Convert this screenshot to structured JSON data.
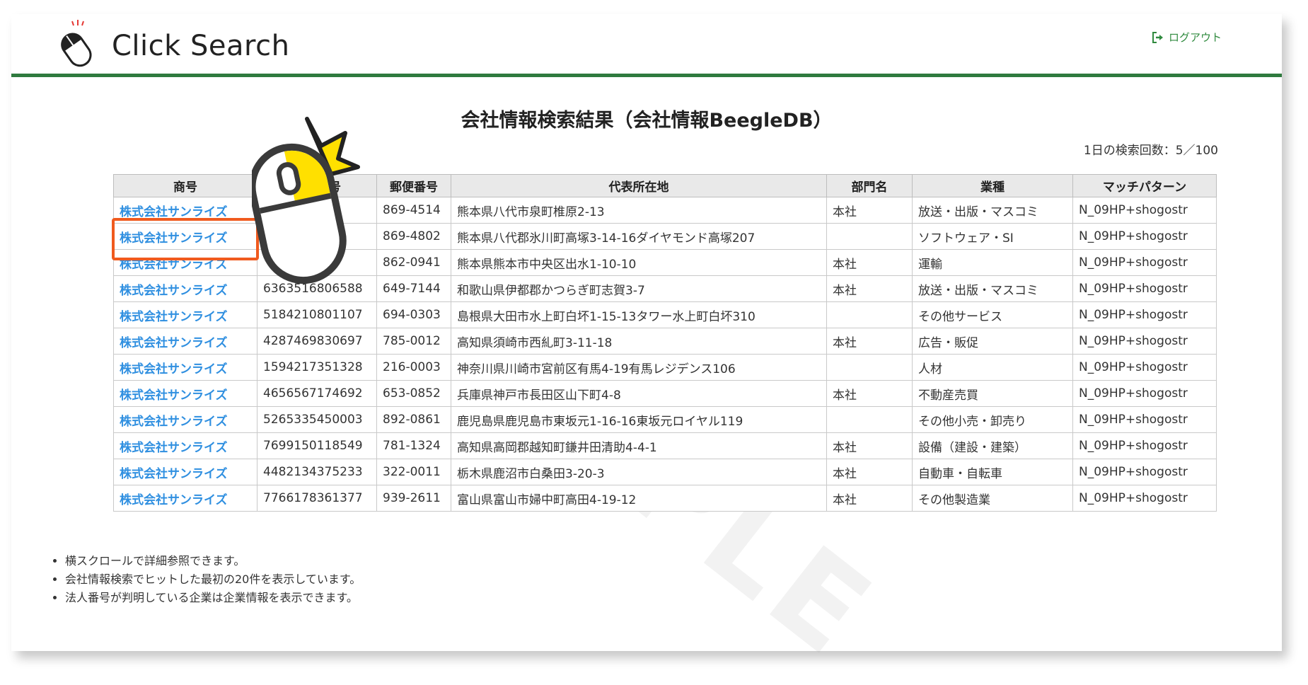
{
  "header": {
    "logo_text": "Click Search",
    "logout_label": "ログアウト"
  },
  "page": {
    "title": "会社情報検索結果（会社情報BeegleDB）",
    "search_count": "1日の検索回数：5／100",
    "watermark": "SAMPLE"
  },
  "table": {
    "columns": [
      "商号",
      "法人番号",
      "郵便番号",
      "代表所在地",
      "部門名",
      "業種",
      "マッチパターン"
    ],
    "rows": [
      {
        "name": "株式会社サンライズ",
        "corp_no": "",
        "zip": "869-4514",
        "address": "熊本県八代市泉町椎原2-13",
        "dept": "本社",
        "industry": "放送・出版・マスコミ",
        "pattern": "N_09HP+shogostr"
      },
      {
        "name": "株式会社サンライズ",
        "corp_no": "",
        "zip": "869-4802",
        "address": "熊本県八代郡氷川町高塚3-14-16ダイヤモンド高塚207",
        "dept": "",
        "industry": "ソフトウェア・SI",
        "pattern": "N_09HP+shogostr"
      },
      {
        "name": "株式会社サンライズ",
        "corp_no": "",
        "zip": "862-0941",
        "address": "熊本県熊本市中央区出水1-10-10",
        "dept": "本社",
        "industry": "運輸",
        "pattern": "N_09HP+shogostr"
      },
      {
        "name": "株式会社サンライズ",
        "corp_no": "6363516806588",
        "zip": "649-7144",
        "address": "和歌山県伊都郡かつらぎ町志賀3-7",
        "dept": "本社",
        "industry": "放送・出版・マスコミ",
        "pattern": "N_09HP+shogostr"
      },
      {
        "name": "株式会社サンライズ",
        "corp_no": "5184210801107",
        "zip": "694-0303",
        "address": "島根県大田市水上町白坏1-15-13タワー水上町白坏310",
        "dept": "",
        "industry": "その他サービス",
        "pattern": "N_09HP+shogostr"
      },
      {
        "name": "株式会社サンライズ",
        "corp_no": "4287469830697",
        "zip": "785-0012",
        "address": "高知県須崎市西糺町3-11-18",
        "dept": "本社",
        "industry": "広告・販促",
        "pattern": "N_09HP+shogostr"
      },
      {
        "name": "株式会社サンライズ",
        "corp_no": "1594217351328",
        "zip": "216-0003",
        "address": "神奈川県川崎市宮前区有馬4-19有馬レジデンス106",
        "dept": "",
        "industry": "人材",
        "pattern": "N_09HP+shogostr"
      },
      {
        "name": "株式会社サンライズ",
        "corp_no": "4656567174692",
        "zip": "653-0852",
        "address": "兵庫県神戸市長田区山下町4-8",
        "dept": "本社",
        "industry": "不動産売買",
        "pattern": "N_09HP+shogostr"
      },
      {
        "name": "株式会社サンライズ",
        "corp_no": "5265335450003",
        "zip": "892-0861",
        "address": "鹿児島県鹿児島市東坂元1-16-16東坂元ロイヤル119",
        "dept": "",
        "industry": "その他小売・卸売り",
        "pattern": "N_09HP+shogostr"
      },
      {
        "name": "株式会社サンライズ",
        "corp_no": "7699150118549",
        "zip": "781-1324",
        "address": "高知県高岡郡越知町鎌井田清助4-4-1",
        "dept": "本社",
        "industry": "設備（建設・建築）",
        "pattern": "N_09HP+shogostr"
      },
      {
        "name": "株式会社サンライズ",
        "corp_no": "4482134375233",
        "zip": "322-0011",
        "address": "栃木県鹿沼市白桑田3-20-3",
        "dept": "本社",
        "industry": "自動車・自転車",
        "pattern": "N_09HP+shogostr"
      },
      {
        "name": "株式会社サンライズ",
        "corp_no": "7766178361377",
        "zip": "939-2611",
        "address": "富山県富山市婦中町高田4-19-12",
        "dept": "本社",
        "industry": "その他製造業",
        "pattern": "N_09HP+shogostr"
      }
    ]
  },
  "notes": [
    "横スクロールで詳細参照できます。",
    "会社情報検索でヒットした最初の20件を表示しています。",
    "法人番号が判明している企業は企業情報を表示できます。"
  ],
  "colors": {
    "accent_green": "#2f7a3e",
    "link_blue": "#2f8fe0",
    "highlight_orange": "#f05a1e",
    "pointer_yellow": "#ffe000"
  },
  "icons": {
    "logo": "mouse-click-icon",
    "logout": "logout-icon",
    "pointer": "mouse-pointer-icon"
  }
}
